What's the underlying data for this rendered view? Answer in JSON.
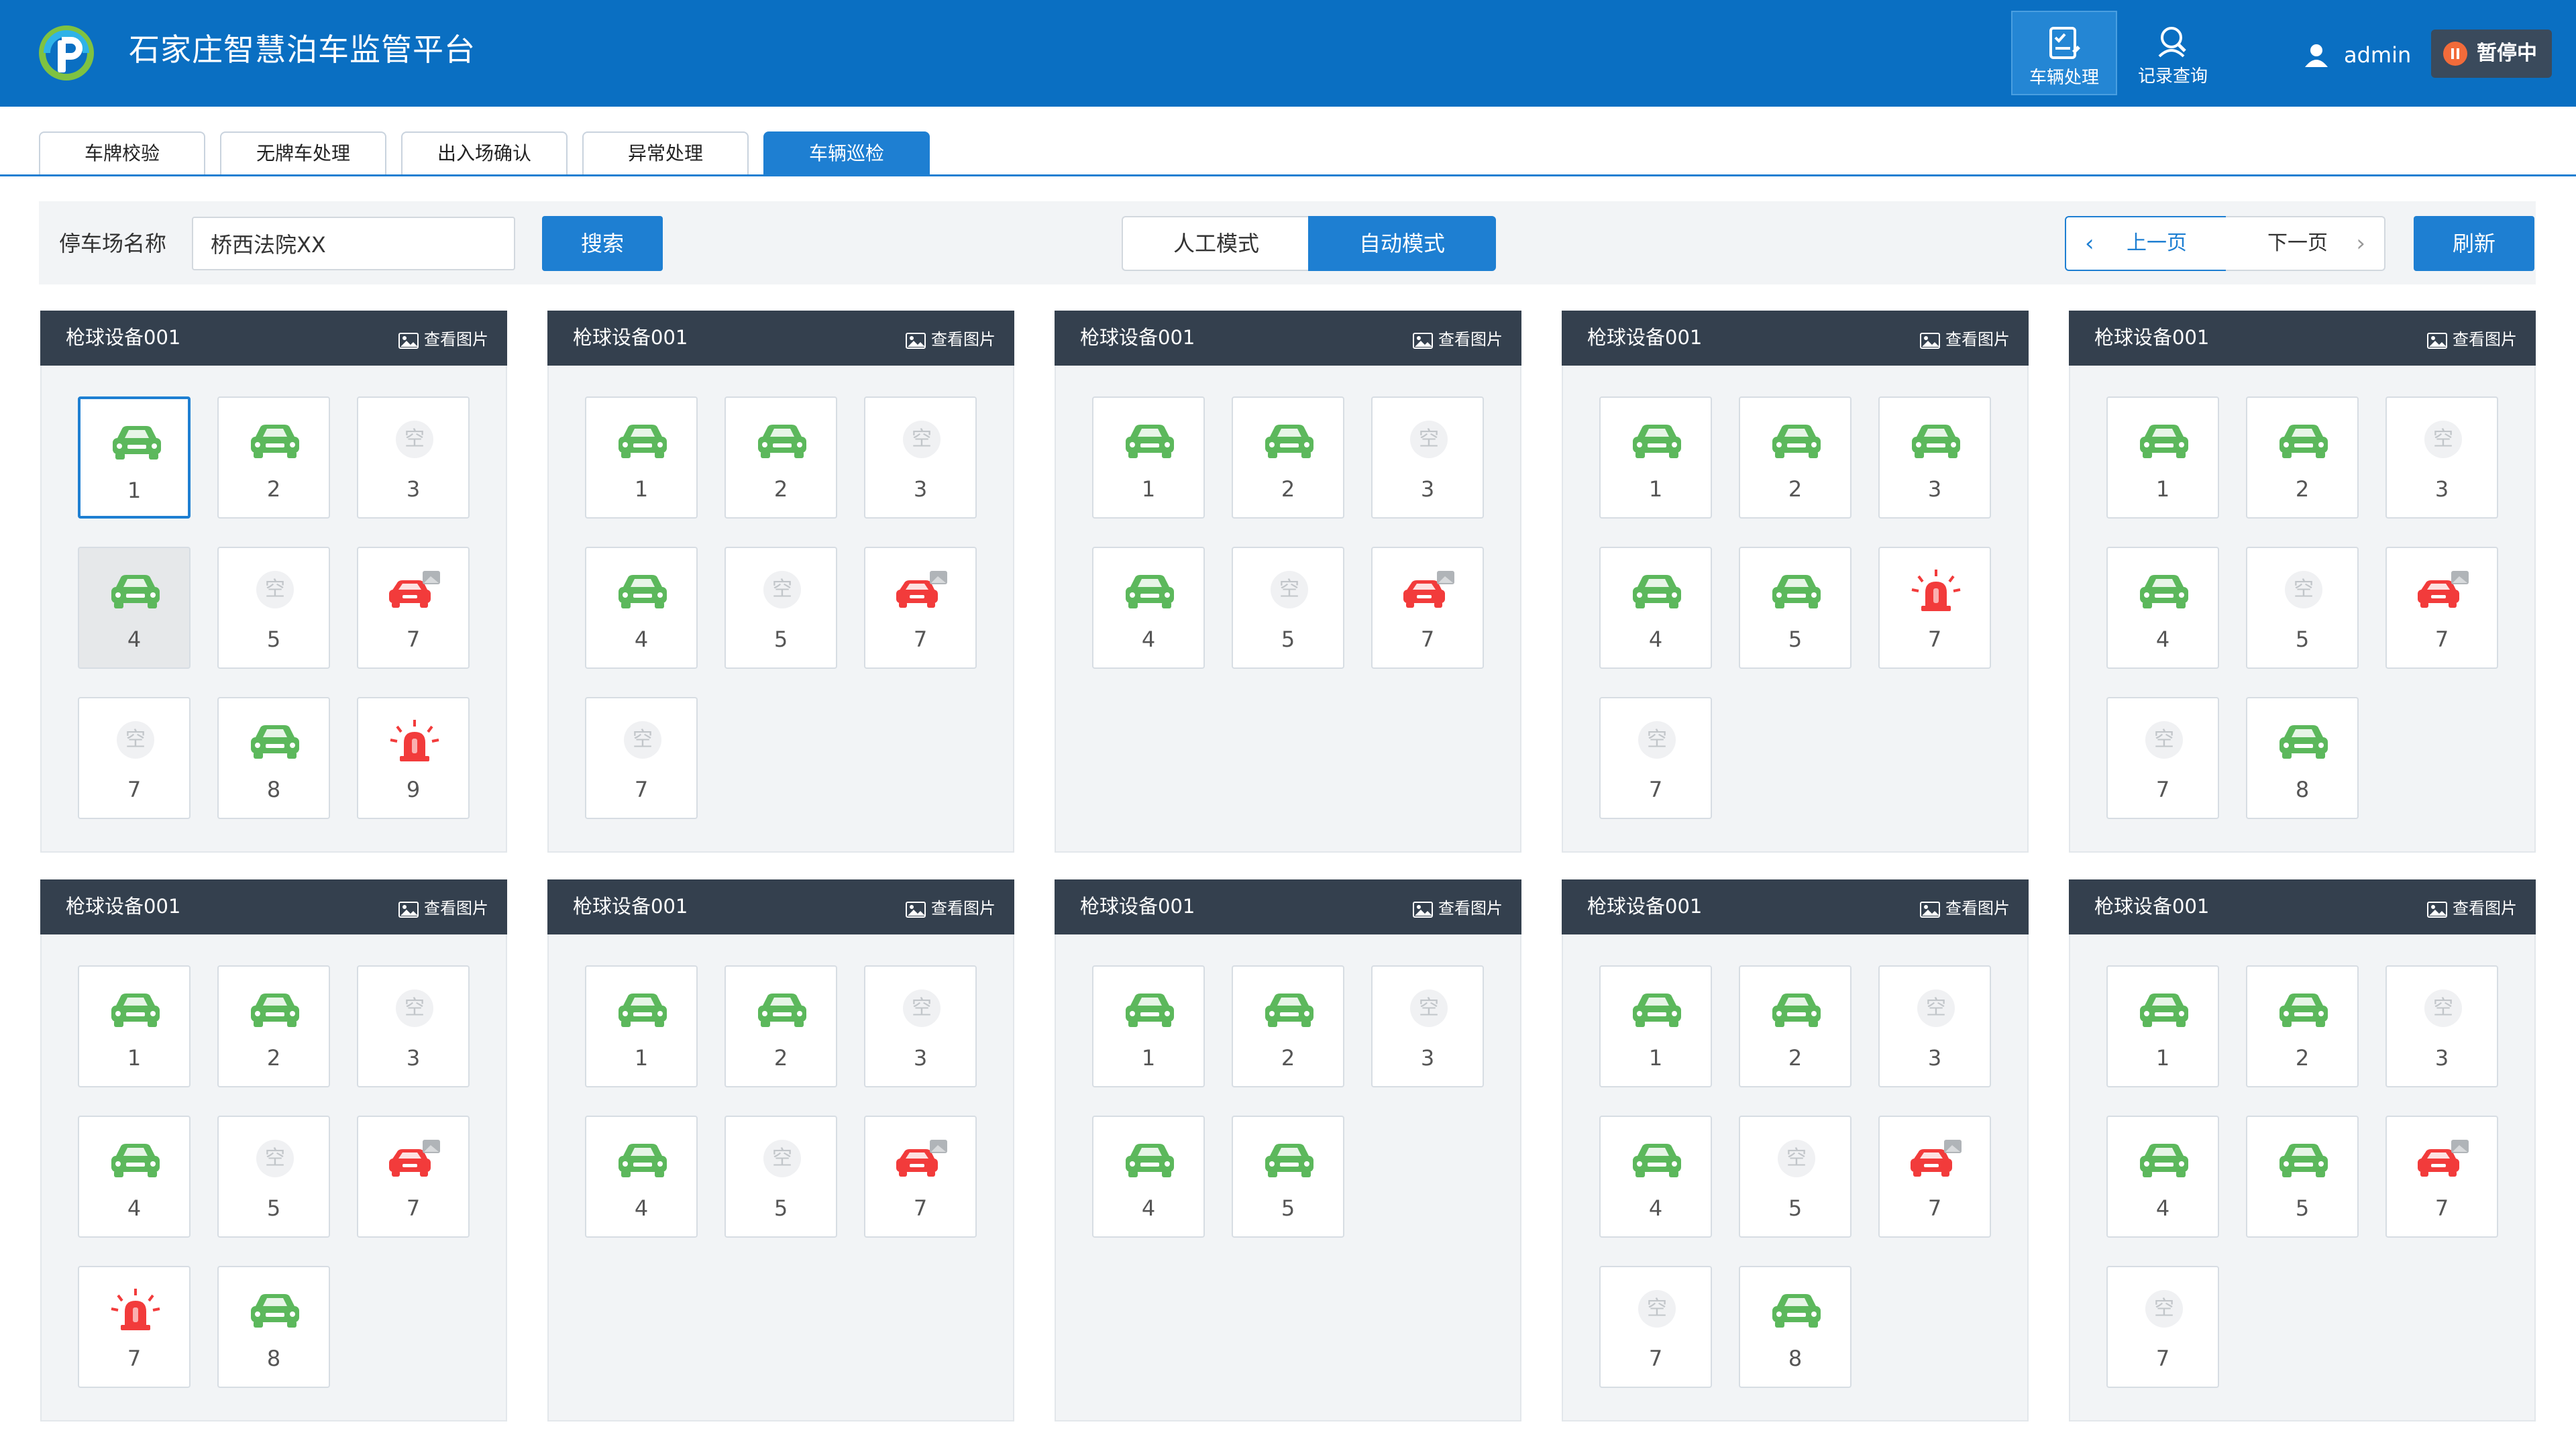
{
  "app": {
    "title": "石家庄智慧泊车监管平台"
  },
  "nav": [
    {
      "label": "车辆处理",
      "icon": "vehicle-check-icon",
      "active": true
    },
    {
      "label": "记录查询",
      "icon": "record-search-icon",
      "active": false
    }
  ],
  "user": {
    "name": "admin",
    "status_label": "暂停中"
  },
  "tabs": [
    {
      "label": "车牌校验",
      "active": false
    },
    {
      "label": "无牌车处理",
      "active": false
    },
    {
      "label": "出入场确认",
      "active": false
    },
    {
      "label": "异常处理",
      "active": false
    },
    {
      "label": "车辆巡检",
      "active": true
    }
  ],
  "toolbar": {
    "lot_label": "停车场名称",
    "lot_value": "桥西法院XX",
    "search_label": "搜索",
    "mode_manual": "人工模式",
    "mode_auto": "自动模式",
    "prev_label": "上一页",
    "next_label": "下一页",
    "refresh_label": "刷新"
  },
  "colors": {
    "header": "#0a6fc2",
    "accent": "#1e7fd2",
    "panel_head": "#34404e",
    "car_ok": "#5cb85c",
    "car_alert": "#f23b3b"
  },
  "legend": {
    "empty_char": "空"
  },
  "panels": [
    {
      "title": "枪球设备001",
      "view_label": "查看图片",
      "slots": [
        {
          "num": "1",
          "status": "car",
          "selected": true
        },
        {
          "num": "2",
          "status": "car"
        },
        {
          "num": "3",
          "status": "empty"
        },
        {
          "num": "4",
          "status": "car",
          "disabled": true
        },
        {
          "num": "5",
          "status": "empty"
        },
        {
          "num": "7",
          "status": "car-alert"
        },
        {
          "num": "7",
          "status": "empty"
        },
        {
          "num": "8",
          "status": "car"
        },
        {
          "num": "9",
          "status": "alarm"
        }
      ]
    },
    {
      "title": "枪球设备001",
      "view_label": "查看图片",
      "slots": [
        {
          "num": "1",
          "status": "car"
        },
        {
          "num": "2",
          "status": "car"
        },
        {
          "num": "3",
          "status": "empty"
        },
        {
          "num": "4",
          "status": "car"
        },
        {
          "num": "5",
          "status": "empty"
        },
        {
          "num": "7",
          "status": "car-alert"
        },
        {
          "num": "7",
          "status": "empty"
        }
      ]
    },
    {
      "title": "枪球设备001",
      "view_label": "查看图片",
      "slots": [
        {
          "num": "1",
          "status": "car"
        },
        {
          "num": "2",
          "status": "car"
        },
        {
          "num": "3",
          "status": "empty"
        },
        {
          "num": "4",
          "status": "car"
        },
        {
          "num": "5",
          "status": "empty"
        },
        {
          "num": "7",
          "status": "car-alert"
        }
      ]
    },
    {
      "title": "枪球设备001",
      "view_label": "查看图片",
      "slots": [
        {
          "num": "1",
          "status": "car"
        },
        {
          "num": "2",
          "status": "car"
        },
        {
          "num": "3",
          "status": "car"
        },
        {
          "num": "4",
          "status": "car"
        },
        {
          "num": "5",
          "status": "car"
        },
        {
          "num": "7",
          "status": "alarm"
        },
        {
          "num": "7",
          "status": "empty"
        }
      ]
    },
    {
      "title": "枪球设备001",
      "view_label": "查看图片",
      "slots": [
        {
          "num": "1",
          "status": "car"
        },
        {
          "num": "2",
          "status": "car"
        },
        {
          "num": "3",
          "status": "empty"
        },
        {
          "num": "4",
          "status": "car"
        },
        {
          "num": "5",
          "status": "empty"
        },
        {
          "num": "7",
          "status": "car-alert"
        },
        {
          "num": "7",
          "status": "empty"
        },
        {
          "num": "8",
          "status": "car"
        }
      ]
    },
    {
      "title": "枪球设备001",
      "view_label": "查看图片",
      "slots": [
        {
          "num": "1",
          "status": "car"
        },
        {
          "num": "2",
          "status": "car"
        },
        {
          "num": "3",
          "status": "empty"
        },
        {
          "num": "4",
          "status": "car"
        },
        {
          "num": "5",
          "status": "empty"
        },
        {
          "num": "7",
          "status": "car-alert"
        },
        {
          "num": "7",
          "status": "alarm"
        },
        {
          "num": "8",
          "status": "car"
        }
      ]
    },
    {
      "title": "枪球设备001",
      "view_label": "查看图片",
      "slots": [
        {
          "num": "1",
          "status": "car"
        },
        {
          "num": "2",
          "status": "car"
        },
        {
          "num": "3",
          "status": "empty"
        },
        {
          "num": "4",
          "status": "car"
        },
        {
          "num": "5",
          "status": "empty"
        },
        {
          "num": "7",
          "status": "car-alert"
        }
      ]
    },
    {
      "title": "枪球设备001",
      "view_label": "查看图片",
      "slots": [
        {
          "num": "1",
          "status": "car"
        },
        {
          "num": "2",
          "status": "car"
        },
        {
          "num": "3",
          "status": "empty"
        },
        {
          "num": "4",
          "status": "car"
        },
        {
          "num": "5",
          "status": "car"
        }
      ]
    },
    {
      "title": "枪球设备001",
      "view_label": "查看图片",
      "slots": [
        {
          "num": "1",
          "status": "car"
        },
        {
          "num": "2",
          "status": "car"
        },
        {
          "num": "3",
          "status": "empty"
        },
        {
          "num": "4",
          "status": "car"
        },
        {
          "num": "5",
          "status": "empty"
        },
        {
          "num": "7",
          "status": "car-alert"
        },
        {
          "num": "7",
          "status": "empty"
        },
        {
          "num": "8",
          "status": "car"
        }
      ]
    },
    {
      "title": "枪球设备001",
      "view_label": "查看图片",
      "slots": [
        {
          "num": "1",
          "status": "car"
        },
        {
          "num": "2",
          "status": "car"
        },
        {
          "num": "3",
          "status": "empty"
        },
        {
          "num": "4",
          "status": "car"
        },
        {
          "num": "5",
          "status": "car"
        },
        {
          "num": "7",
          "status": "car-alert"
        },
        {
          "num": "7",
          "status": "empty"
        }
      ]
    }
  ]
}
